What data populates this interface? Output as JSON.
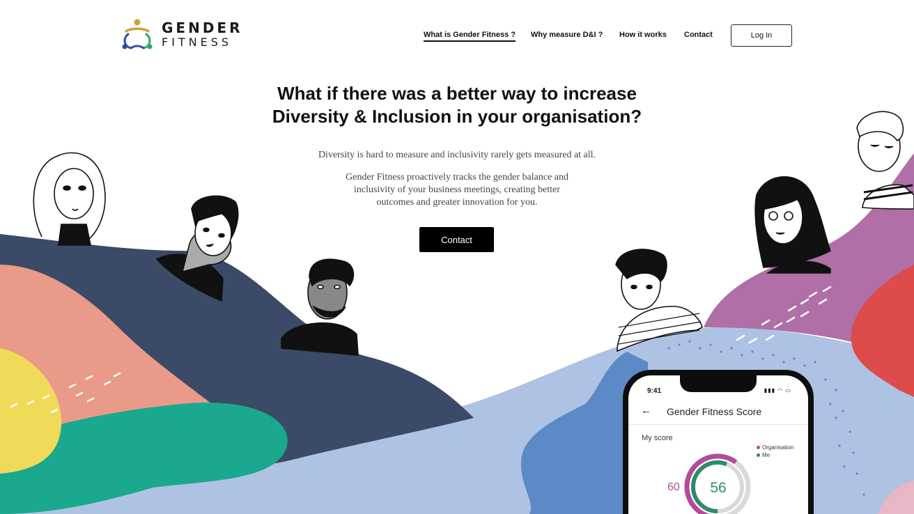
{
  "brand": {
    "name_line1": "GENDER",
    "name_line2": "FITNESS"
  },
  "nav": {
    "items": [
      {
        "label": "What is Gender Fitness ?",
        "active": true
      },
      {
        "label": "Why measure D&I ?",
        "active": false
      },
      {
        "label": "How it works",
        "active": false
      },
      {
        "label": "Contact",
        "active": false
      }
    ],
    "login_label": "Log In"
  },
  "hero": {
    "title_line1": "What if there was a better way to increase",
    "title_line2": "Diversity & Inclusion in your organisation?",
    "paragraph1": "Diversity is hard to measure and inclusivity rarely gets measured at all.",
    "paragraph2": "Gender Fitness proactively tracks the gender balance and inclusivity of your business meetings, creating better outcomes and greater innovation for you.",
    "cta_label": "Contact"
  },
  "phone": {
    "status_time": "9:41",
    "screen_title": "Gender Fitness Score",
    "section_label": "My score",
    "legend": [
      {
        "label": "Organisation",
        "color": "#b14c9a"
      },
      {
        "label": "Me",
        "color": "#2e8b6a"
      }
    ],
    "organisation_score": "60",
    "my_score": "56"
  },
  "colors": {
    "navy": "#3a4a67",
    "coral": "#ea9a88",
    "teal": "#1aa88e",
    "yellow": "#f0da5a",
    "light_blue": "#aec3e3",
    "blue": "#5b8ac6",
    "purple": "#b06fa6",
    "red": "#dd4b4a"
  }
}
